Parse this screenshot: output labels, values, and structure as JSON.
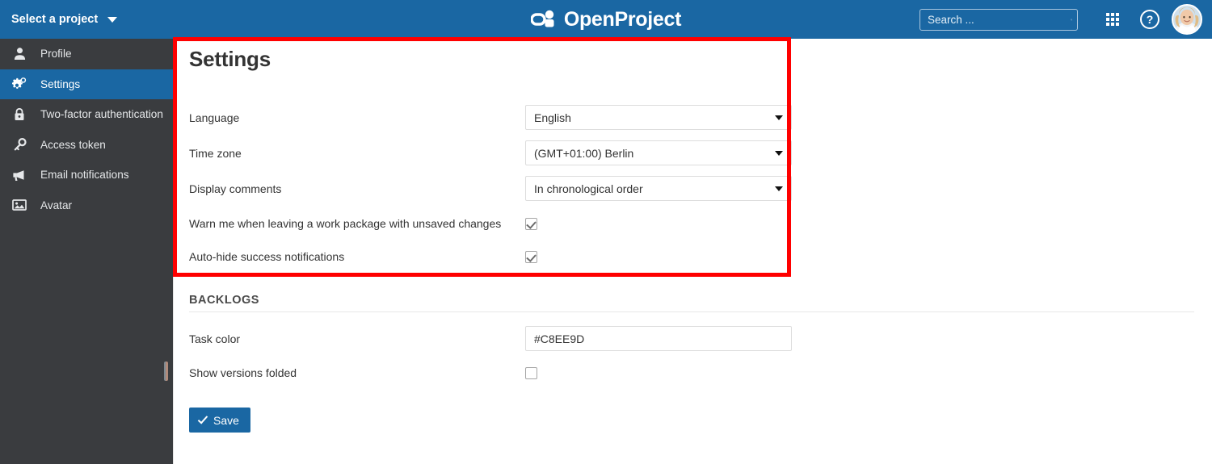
{
  "header": {
    "project_select_label": "Select a project",
    "logo_text": "OpenProject",
    "search_placeholder": "Search ...",
    "search_value": "",
    "icons": {
      "search": "search-icon",
      "modules": "grid-icon",
      "help": "help-icon",
      "avatar": "avatar"
    },
    "help_glyph": "?",
    "background_color": "#1A67A3"
  },
  "sidebar": {
    "background_color": "#3a3c3f",
    "active_color": "#1A67A3",
    "items": [
      {
        "label": "Profile",
        "icon": "person-icon",
        "active": false
      },
      {
        "label": "Settings",
        "icon": "gear-icon",
        "active": true
      },
      {
        "label": "Two-factor authentication",
        "icon": "lock-icon",
        "active": false
      },
      {
        "label": "Access token",
        "icon": "key-icon",
        "active": false
      },
      {
        "label": "Email notifications",
        "icon": "megaphone-icon",
        "active": false
      },
      {
        "label": "Avatar",
        "icon": "image-icon",
        "active": false
      }
    ]
  },
  "main": {
    "page_title": "Settings",
    "settings_rows": [
      {
        "label": "Language",
        "type": "select",
        "value": "English"
      },
      {
        "label": "Time zone",
        "type": "select",
        "value": "(GMT+01:00) Berlin"
      },
      {
        "label": "Display comments",
        "type": "select",
        "value": "In chronological order"
      },
      {
        "label": "Warn me when leaving a work package with unsaved changes",
        "type": "checkbox",
        "checked": true
      },
      {
        "label": "Auto-hide success notifications",
        "type": "checkbox",
        "checked": true
      }
    ],
    "backlogs": {
      "heading": "BACKLOGS",
      "rows": [
        {
          "label": "Task color",
          "type": "text",
          "value": "#C8EE9D"
        },
        {
          "label": "Show versions folded",
          "type": "checkbox",
          "checked": false
        }
      ]
    },
    "save_label": "Save"
  },
  "annotation": {
    "highlight_color": "#FF0000"
  }
}
